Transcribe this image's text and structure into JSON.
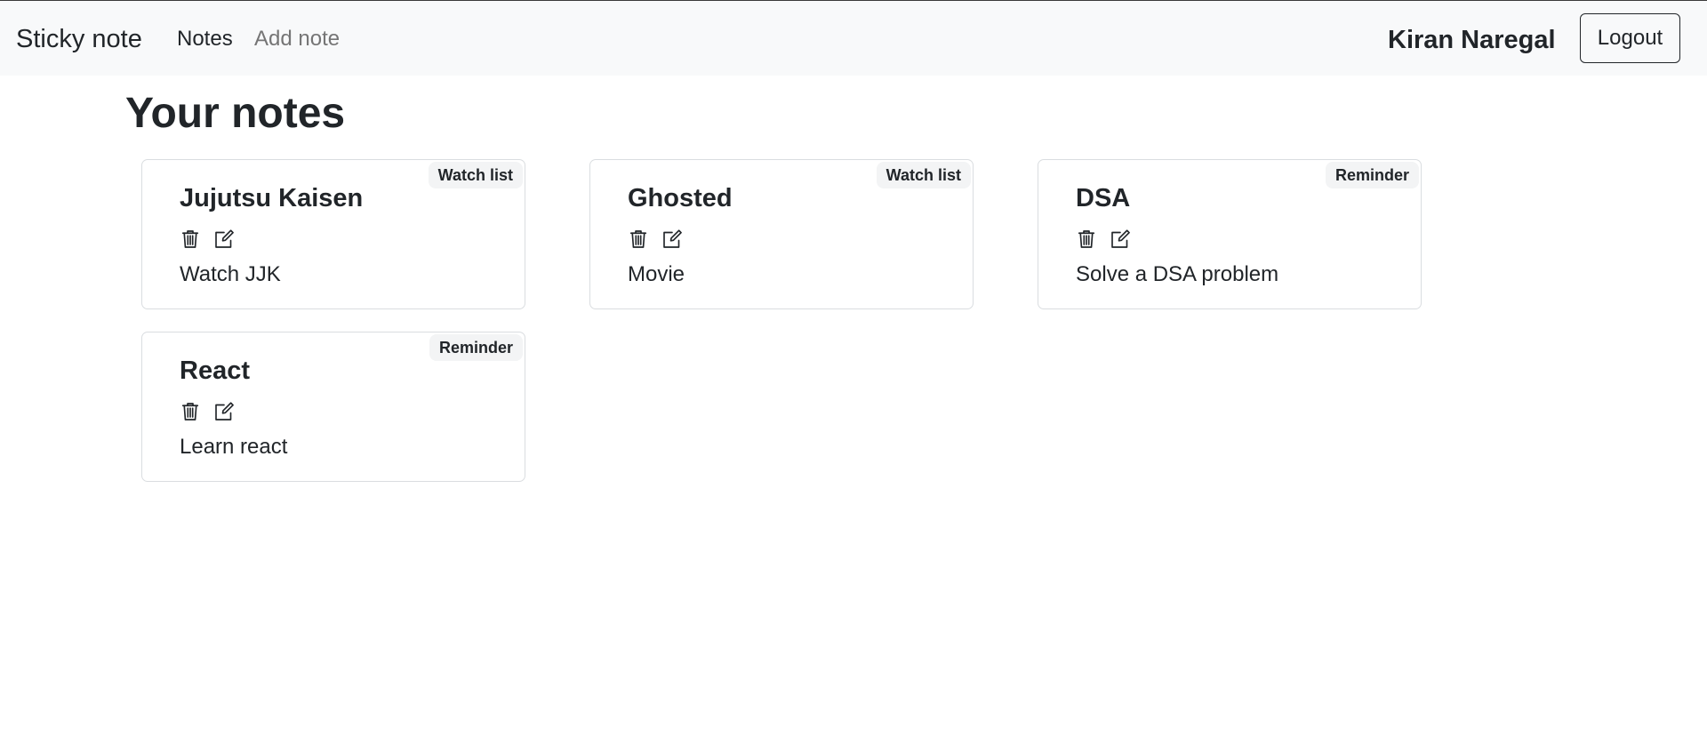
{
  "navbar": {
    "brand": "Sticky note",
    "links": [
      {
        "label": "Notes"
      },
      {
        "label": "Add note"
      }
    ],
    "username": "Kiran Naregal",
    "logout_label": "Logout"
  },
  "main": {
    "title": "Your notes",
    "notes": [
      {
        "tag": "Watch list",
        "title": "Jujutsu Kaisen",
        "description": "Watch JJK",
        "delete_icon": "trash-icon",
        "edit_icon": "edit-icon"
      },
      {
        "tag": "Watch list",
        "title": "Ghosted",
        "description": "Movie",
        "delete_icon": "trash-icon",
        "edit_icon": "edit-icon"
      },
      {
        "tag": "Reminder",
        "title": "DSA",
        "description": "Solve a DSA problem",
        "delete_icon": "trash-icon",
        "edit_icon": "edit-icon"
      },
      {
        "tag": "Reminder",
        "title": "React",
        "description": "Learn react",
        "delete_icon": "trash-icon",
        "edit_icon": "edit-icon"
      }
    ]
  },
  "colors": {
    "navbar_bg": "#f8f9fa",
    "text": "#212529",
    "muted_link": "#757575",
    "card_border": "#dadde0",
    "badge_bg": "#f3f4f5"
  }
}
